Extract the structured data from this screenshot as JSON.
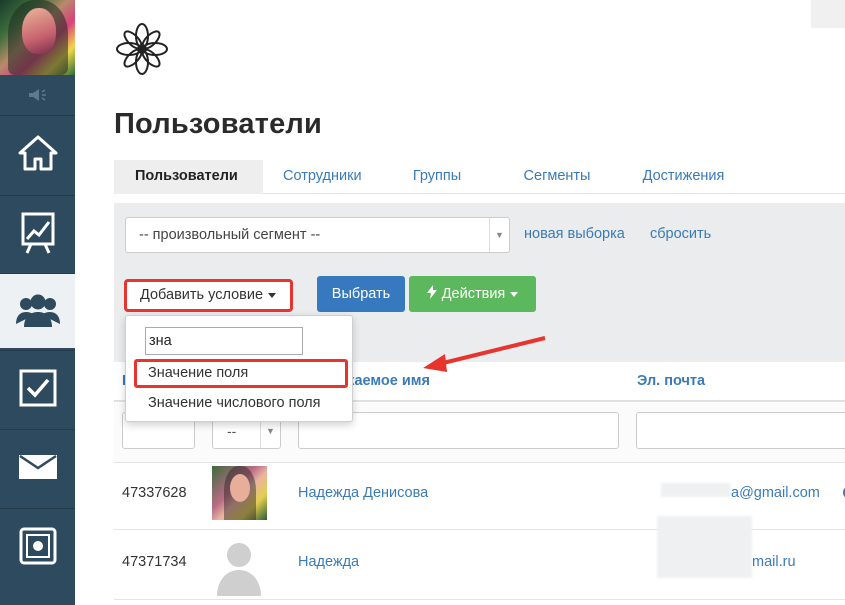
{
  "page": {
    "title": "Пользователи"
  },
  "tabs": [
    {
      "label": "Пользователи"
    },
    {
      "label": "Сотрудники"
    },
    {
      "label": "Группы"
    },
    {
      "label": "Сегменты"
    },
    {
      "label": "Достижения"
    }
  ],
  "filter": {
    "segment_value": "-- произвольный сегмент --",
    "new_query": "новая выборка",
    "reset": "сбросить",
    "add_condition": "Добавить условие",
    "select_button": "Выбрать",
    "actions_button": "Действия"
  },
  "dropdown": {
    "search_value": "зна",
    "items": [
      {
        "label": "Значение поля"
      },
      {
        "label": "Значение числового поля"
      }
    ]
  },
  "table": {
    "columns": [
      "Отображаемое имя",
      "Эл. почта"
    ],
    "col_id_partial": "I",
    "col_name_partial": "жаемое имя",
    "filter_select_value": "--",
    "rows": [
      {
        "id": "47337628",
        "name": "Надежда Денисова",
        "email": "a@gmail.com"
      },
      {
        "id": "47371734",
        "name": "Надежда",
        "email": "mail.ru"
      }
    ]
  },
  "colors": {
    "sidebar": "#2e4a5f",
    "link": "#3a7bb7",
    "primary": "#3779be",
    "success": "#5cb85c",
    "highlight": "#e8342f"
  },
  "icons": [
    "speaker-icon",
    "home-icon",
    "chart-icon",
    "users-icon",
    "checkbox-icon",
    "mail-icon",
    "safe-icon",
    "lotus-logo",
    "bolt-icon",
    "chevron-circle-icon"
  ]
}
